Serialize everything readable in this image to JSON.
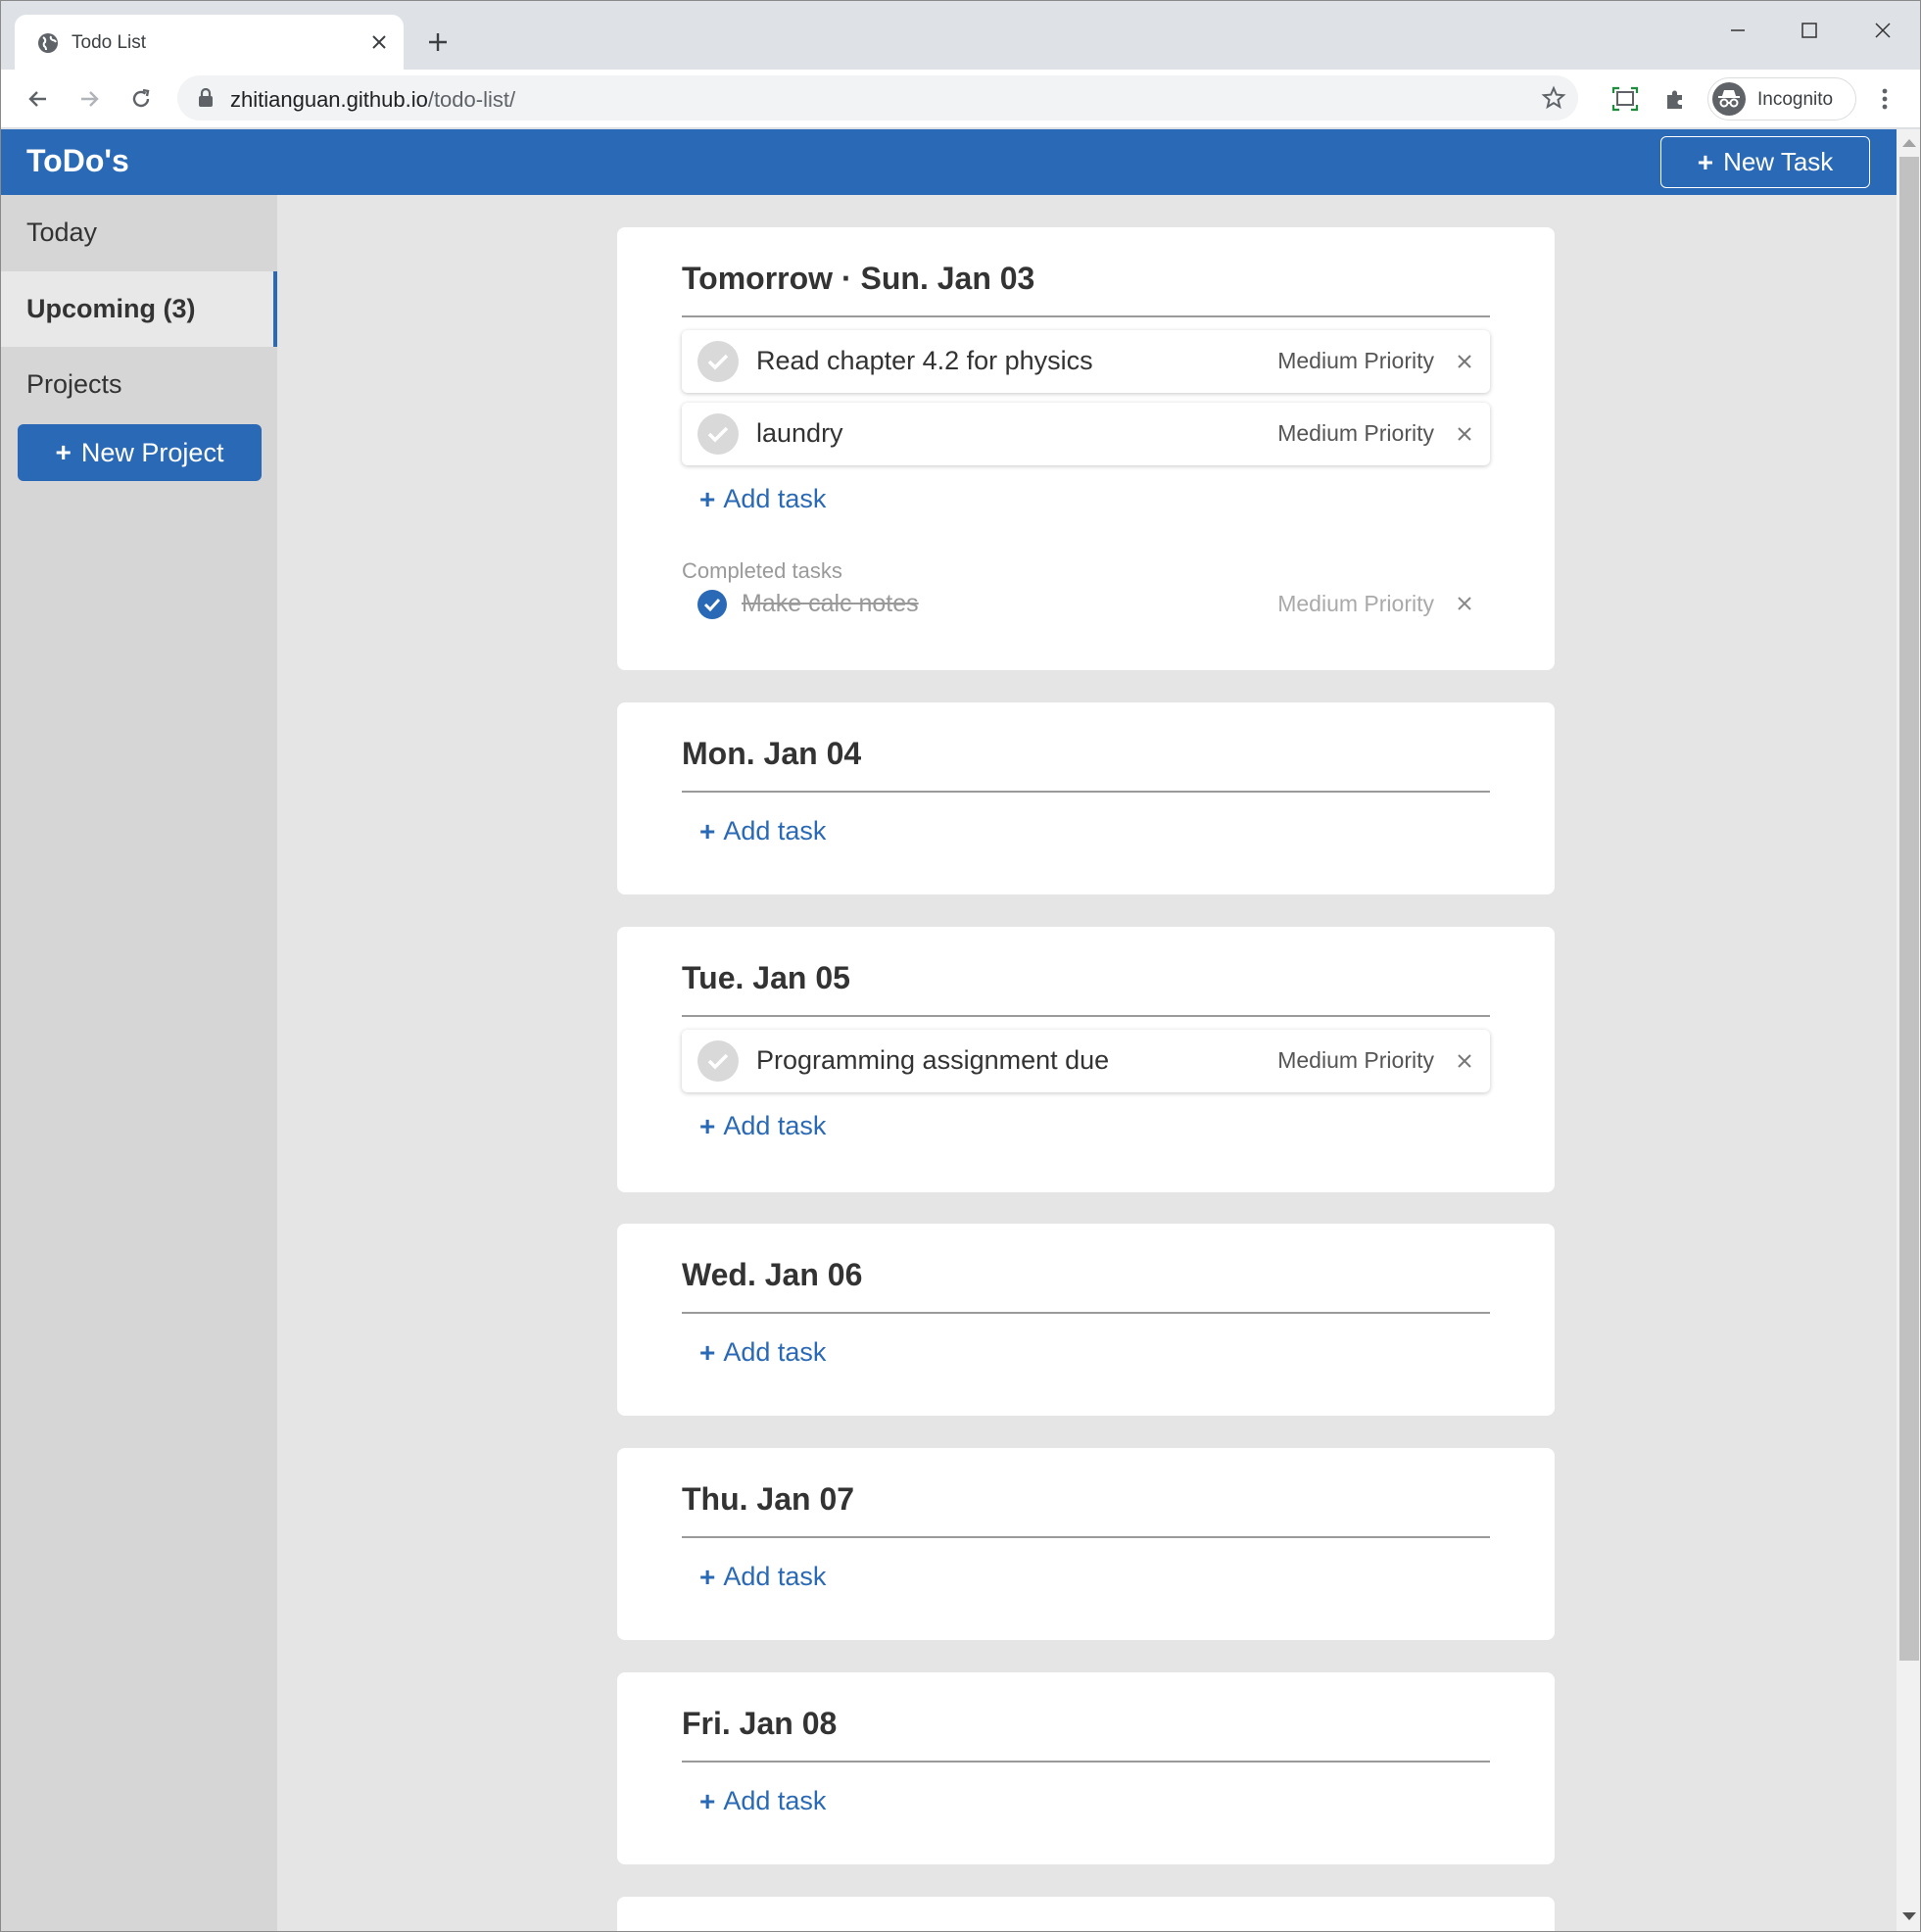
{
  "browser": {
    "tab_title": "Todo List",
    "url_host": "zhitianguan.github.io",
    "url_path": "/todo-list/",
    "profile_label": "Incognito"
  },
  "app": {
    "title": "ToDo's",
    "new_task_label": "New Task",
    "accent_color": "#2a69b5"
  },
  "sidebar": {
    "items": [
      {
        "label": "Today"
      },
      {
        "label": "Upcoming (3)",
        "active": true
      },
      {
        "label": "Projects"
      }
    ],
    "new_project_label": "New Project"
  },
  "days": [
    {
      "title": "Tomorrow · Sun. Jan 03",
      "tasks": [
        {
          "text": "Read chapter 4.2 for physics",
          "priority": "Medium Priority"
        },
        {
          "text": "laundry",
          "priority": "Medium Priority"
        }
      ],
      "add_label": "Add task",
      "completed_label": "Completed tasks",
      "completed": [
        {
          "text": "Make calc notes",
          "priority": "Medium Priority"
        }
      ]
    },
    {
      "title": "Mon. Jan 04",
      "tasks": [],
      "add_label": "Add task"
    },
    {
      "title": "Tue. Jan 05",
      "tasks": [
        {
          "text": "Programming assignment due",
          "priority": "Medium Priority"
        }
      ],
      "add_label": "Add task"
    },
    {
      "title": "Wed. Jan 06",
      "tasks": [],
      "add_label": "Add task"
    },
    {
      "title": "Thu. Jan 07",
      "tasks": [],
      "add_label": "Add task"
    },
    {
      "title": "Fri. Jan 08",
      "tasks": [],
      "add_label": "Add task"
    }
  ]
}
